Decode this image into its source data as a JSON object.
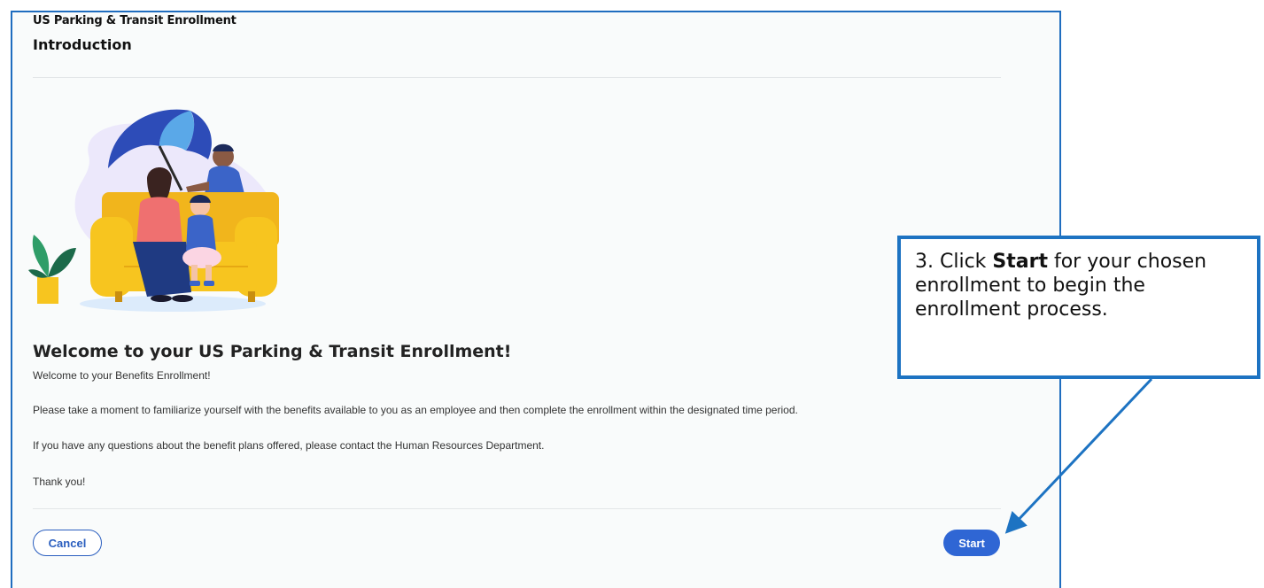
{
  "header": {
    "subtitle": "US Parking & Transit Enrollment",
    "title": "Introduction"
  },
  "illustration": {
    "name": "family-on-couch-under-umbrella"
  },
  "content": {
    "heading": "Welcome to your US Parking & Transit Enrollment!",
    "paragraphs": [
      "Welcome to your Benefits Enrollment!",
      "Please take a moment to familiarize yourself with the benefits available to you as an employee and then complete the enrollment within the designated time period.",
      "If you have any questions about the benefit plans offered, please contact the Human Resources Department.",
      "Thank you!"
    ]
  },
  "footer": {
    "cancel_label": "Cancel",
    "start_label": "Start"
  },
  "callout": {
    "prefix": "3. Click ",
    "emphasis": "Start",
    "suffix": " for your chosen enrollment to begin the enrollment process."
  },
  "colors": {
    "accent": "#2f66d4",
    "panel_border": "#1f6dbf",
    "callout_border": "#1d73c2",
    "panel_background": "#f9fbfb"
  }
}
